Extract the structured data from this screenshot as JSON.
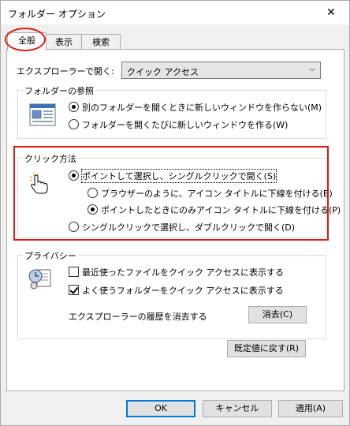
{
  "window": {
    "title": "フォルダー オプション",
    "close_glyph": "✕"
  },
  "tabs": [
    {
      "label": "全般",
      "active": true
    },
    {
      "label": "表示",
      "active": false
    },
    {
      "label": "検索",
      "active": false
    }
  ],
  "explorer_open": {
    "label": "エクスプローラーで開く:",
    "value": "クイック アクセス"
  },
  "folder_browse": {
    "title": "フォルダーの参照",
    "opt_new_window_off": "別のフォルダーを開くときに新しいウィンドウを作らない(M)",
    "opt_new_window_on": "フォルダーを開くたびに新しいウィンドウを作る(W)",
    "selected": "opt_new_window_off"
  },
  "click_method": {
    "title": "クリック方法",
    "opt_single": "ポイントして選択し、シングルクリックで開く(S)",
    "sub_browser": "ブラウザーのように、アイコン タイトルに下線を付ける(B)",
    "sub_point": "ポイントしたときにのみアイコン タイトルに下線を付ける(P)",
    "opt_double": "シングルクリックで選択し、ダブルクリックで開く(D)",
    "selected": "opt_single",
    "sub_selected": "sub_point"
  },
  "privacy": {
    "title": "プライバシー",
    "recent_files": {
      "label": "最近使ったファイルをクイック アクセスに表示する",
      "checked": false
    },
    "frequent_folders": {
      "label": "よく使うフォルダーをクイック アクセスに表示する",
      "checked": true
    },
    "clear_label": "エクスプローラーの履歴を消去する",
    "clear_button": "消去(C)"
  },
  "restore_defaults": "既定値に戻す(R)",
  "footer": {
    "ok": "OK",
    "cancel": "キャンセル",
    "apply": "適用(A)"
  },
  "annotation_color": "#d71a1a"
}
